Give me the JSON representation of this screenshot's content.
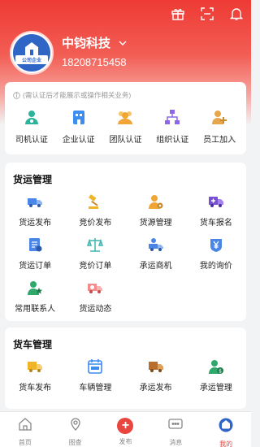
{
  "header": {
    "company_name": "中钧科技",
    "phone": "18208715458",
    "avatar_label": "公司企业"
  },
  "certification": {
    "notice": "(需认证后才能展示或操作相关业务)",
    "items": [
      {
        "label": "司机认证",
        "icon": "driver-cert-icon",
        "color": "#2bb39b"
      },
      {
        "label": "企业认证",
        "icon": "enterprise-cert-icon",
        "color": "#3d8cf0"
      },
      {
        "label": "团队认证",
        "icon": "team-cert-icon",
        "color": "#f0a534"
      },
      {
        "label": "组织认证",
        "icon": "org-cert-icon",
        "color": "#8c68e6"
      },
      {
        "label": "员工加入",
        "icon": "staff-join-icon",
        "color": "#e7a64b"
      }
    ]
  },
  "freight": {
    "title": "货运管理",
    "items": [
      {
        "label": "货运发布"
      },
      {
        "label": "竞价发布"
      },
      {
        "label": "货源管理"
      },
      {
        "label": "货车报名"
      },
      {
        "label": "货运订单"
      },
      {
        "label": "竞价订单"
      },
      {
        "label": "承运商机"
      },
      {
        "label": "我的询价"
      },
      {
        "label": "常用联系人"
      },
      {
        "label": "货运动态"
      }
    ]
  },
  "truck": {
    "title": "货车管理",
    "items": [
      {
        "label": "货车发布"
      },
      {
        "label": "车辆管理"
      },
      {
        "label": "承运发布"
      },
      {
        "label": "承运管理"
      }
    ]
  },
  "tabbar": {
    "items": [
      {
        "label": "首页"
      },
      {
        "label": "图查"
      },
      {
        "label": "发布"
      },
      {
        "label": "消息"
      },
      {
        "label": "我的"
      }
    ],
    "active_color": "#e8463f"
  },
  "colors": {
    "brand_red": "#ee3a34"
  }
}
